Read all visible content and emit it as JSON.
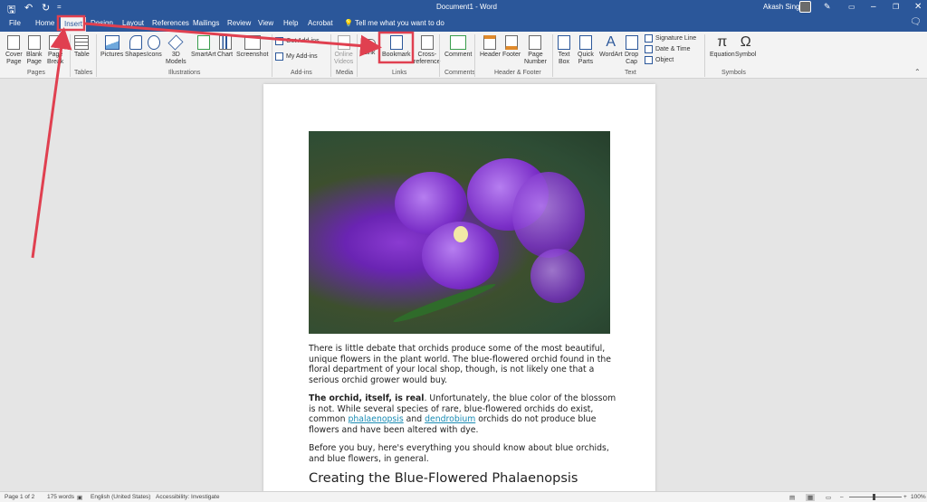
{
  "titlebar": {
    "doc_title": "Document1 - Word",
    "user_name": "Akash Singh",
    "quick_save": "🖫",
    "undo": "↶",
    "redo": "↻",
    "customize": "="
  },
  "tabs": [
    "File",
    "Home",
    "Insert",
    "Design",
    "Layout",
    "References",
    "Mailings",
    "Review",
    "View",
    "Help",
    "Acrobat"
  ],
  "tell_me": "Tell me what you want to do",
  "ribbon": {
    "pages": {
      "label": "Pages",
      "cover": "Cover\nPage",
      "blank": "Blank\nPage",
      "break": "Page\nBreak"
    },
    "tables": {
      "label": "Tables",
      "table": "Table"
    },
    "illustrations": {
      "label": "Illustrations",
      "pictures": "Pictures",
      "shapes": "Shapes",
      "icons": "Icons",
      "models": "3D\nModels",
      "smartart": "SmartArt",
      "chart": "Chart",
      "screenshot": "Screenshot"
    },
    "addins": {
      "label": "Add-ins",
      "get": "Get Add-ins",
      "my": "My Add-ins"
    },
    "media": {
      "label": "Media",
      "video": "Online\nVideos"
    },
    "links": {
      "label": "Links",
      "link": "Link",
      "bookmark": "Bookmark",
      "crossref": "Cross-\nreference"
    },
    "comments": {
      "label": "Comments",
      "comment": "Comment"
    },
    "header_footer": {
      "label": "Header & Footer",
      "header": "Header",
      "footer": "Footer",
      "pagenum": "Page\nNumber"
    },
    "text": {
      "label": "Text",
      "textbox": "Text\nBox",
      "quickparts": "Quick\nParts",
      "wordart": "WordArt",
      "dropcap": "Drop\nCap",
      "sigline": "Signature Line",
      "datetime": "Date & Time",
      "object": "Object"
    },
    "symbols": {
      "label": "Symbols",
      "equation": "Equation",
      "symbol": "Symbol"
    }
  },
  "document": {
    "p1": "There is little debate that orchids produce some of the most beautiful, unique flowers in the plant world. The blue-flowered orchid found in the floral department of your local shop, though, is not likely one that a serious orchid grower would buy.",
    "p2_bold": "The orchid, itself, is real",
    "p2_a": ". Unfortunately, the blue color of the blossom is not. While several species of rare, blue-flowered orchids do exist, common ",
    "p2_link1": "phalaenopsis",
    "p2_b": " and ",
    "p2_link2": "dendrobium",
    "p2_c": " orchids do not produce blue flowers and have been altered with dye.",
    "p3": "Before you buy, here's everything you should know about blue orchids, and blue flowers, in general.",
    "heading": "Creating the Blue-Flowered Phalaenopsis"
  },
  "status": {
    "page": "Page 1 of 2",
    "words": "175 words",
    "language": "English (United States)",
    "accessibility": "Accessibility: Investigate",
    "zoom": "100%"
  },
  "colors": {
    "accent": "#2b579a",
    "annotation": "#e04050",
    "link": "#1a8bb3"
  }
}
